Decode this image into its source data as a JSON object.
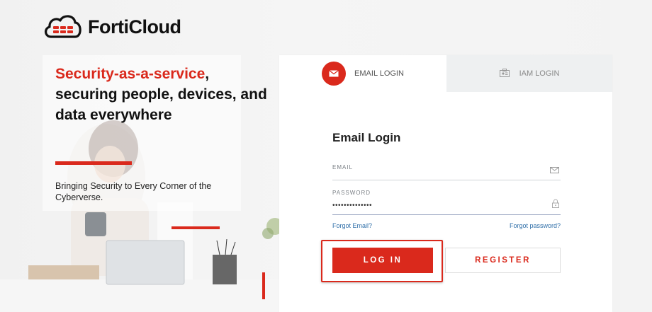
{
  "header": {
    "brand": "FortiCloud",
    "logo_icon": "forticloud-logo-icon"
  },
  "hero": {
    "headline_accent": "Security-as-a-service",
    "headline_rest": ", securing people, devices, and data everywhere",
    "tagline": "Bringing Security to Every Corner of the Cyberverse."
  },
  "tabs": [
    {
      "label": "EMAIL LOGIN",
      "icon": "envelope-icon",
      "active": true
    },
    {
      "label": "IAM LOGIN",
      "icon": "id-card-icon",
      "active": false
    }
  ],
  "form": {
    "title": "Email Login",
    "email_label": "EMAIL",
    "email_value": "",
    "password_label": "PASSWORD",
    "password_value": "••••••••••••••",
    "forgot_email": "Forgot Email?",
    "forgot_password": "Forgot password?",
    "login_button": "LOG IN",
    "register_button": "REGISTER"
  },
  "colors": {
    "accent": "#da291c",
    "link": "#2e6ea8",
    "inactive_tab": "#eef0f1"
  }
}
